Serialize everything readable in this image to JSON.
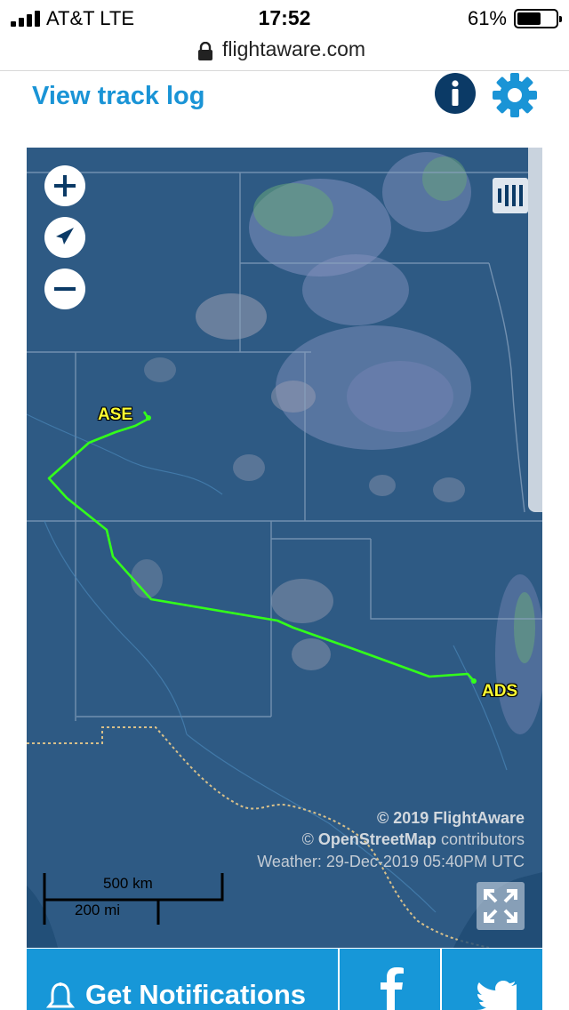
{
  "status_bar": {
    "carrier": "AT&T   LTE",
    "time": "17:52",
    "battery_percent": "61%",
    "battery_level": 0.61,
    "signal_bars": 4
  },
  "browser": {
    "url": "flightaware.com",
    "lock_icon": "lock-icon"
  },
  "header": {
    "track_log_label": "View track log",
    "info_icon": "info-icon",
    "settings_icon": "gear-icon",
    "accent_color": "#1a94d6",
    "info_color": "#0b3a66"
  },
  "map": {
    "controls": [
      "zoom-in-icon",
      "compass-icon",
      "zoom-out-icon"
    ],
    "layers_icon": "layers-icon",
    "origin_code": "ASE",
    "destination_code": "ADS",
    "route_color": "#33ff1a",
    "label_color": "#ffff33",
    "attribution_line1": "© 2019 FlightAware",
    "attribution_osm_symbol": "©",
    "attribution_osm_name": "OpenStreetMap",
    "attribution_osm_suffix": "contributors",
    "attribution_weather": "Weather: 29-Dec-2019 05:40PM UTC",
    "scale_km": "500 km",
    "scale_mi": "200 mi",
    "fullscreen_icon": "expand-icon"
  },
  "bottom_bar": {
    "notifications_label": "Get Notifications",
    "bell_icon": "bell-icon",
    "facebook_icon": "facebook-icon",
    "twitter_icon": "twitter-icon",
    "bar_color": "#1797d8"
  }
}
